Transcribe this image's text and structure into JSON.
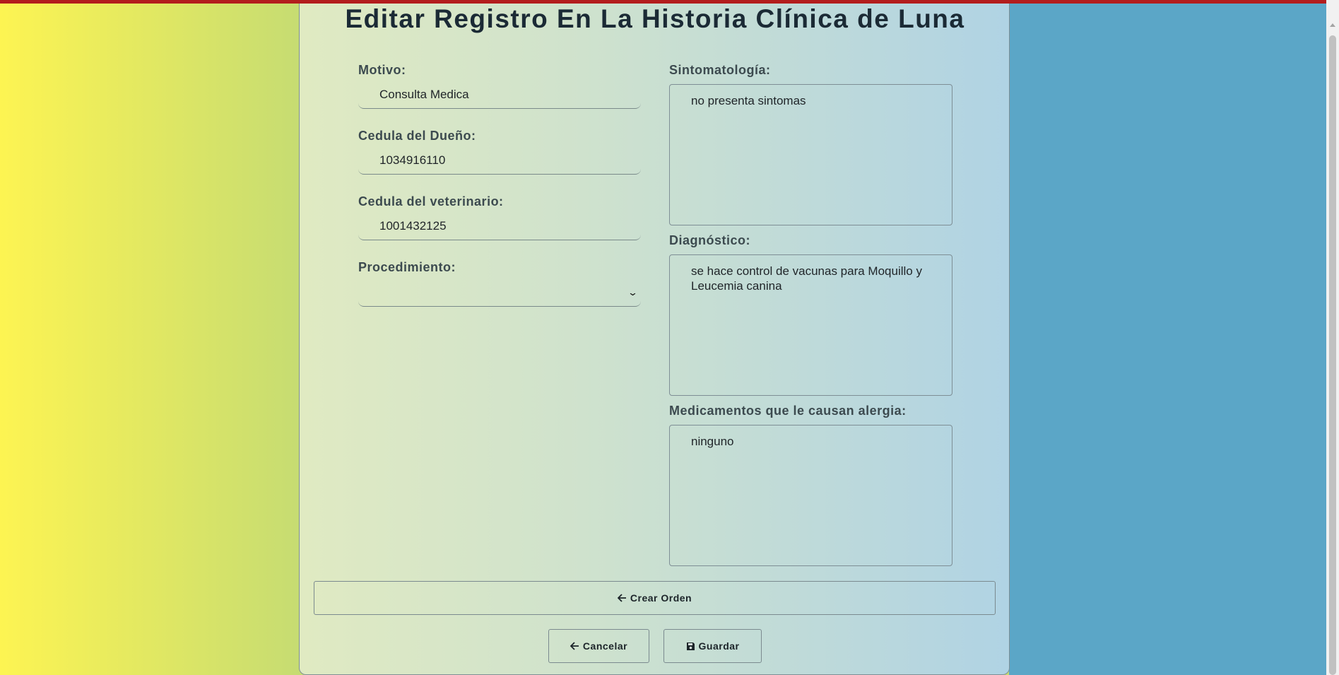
{
  "page": {
    "title": "Editar Registro En La Historia Clínica de Luna"
  },
  "form": {
    "motivo": {
      "label": "Motivo:",
      "value": "Consulta Medica"
    },
    "cedula_dueno": {
      "label": "Cedula del Dueño:",
      "value": "1034916110"
    },
    "cedula_veterinario": {
      "label": "Cedula del veterinario:",
      "value": "1001432125"
    },
    "procedimiento": {
      "label": "Procedimiento:",
      "value": ""
    },
    "sintomatologia": {
      "label": "Sintomatología:",
      "value": "no presenta sintomas"
    },
    "diagnostico": {
      "label": "Diagnóstico:",
      "value": "se hace control de vacunas para Moquillo y Leucemia canina"
    },
    "alergias": {
      "label": "Medicamentos que le causan alergia:",
      "value": "ninguno"
    }
  },
  "buttons": {
    "crear_orden": {
      "label": "Crear Orden",
      "icon": "arrow-left-icon"
    },
    "cancelar": {
      "label": "Cancelar",
      "icon": "arrow-left-icon"
    },
    "guardar": {
      "label": "Guardar",
      "icon": "floppy-disk-icon"
    }
  },
  "colors": {
    "top_bar": "#b31d1d",
    "left_background": "#fdf452",
    "right_background": "#5ba6c7"
  }
}
